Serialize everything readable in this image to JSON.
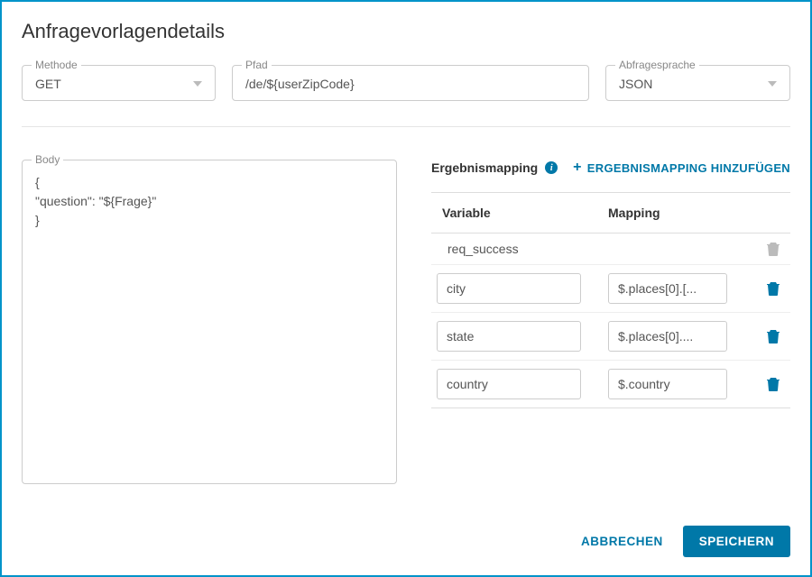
{
  "title": "Anfragevorlagendetails",
  "fields": {
    "method": {
      "label": "Methode",
      "value": "GET"
    },
    "path": {
      "label": "Pfad",
      "value": "/de/${userZipCode}"
    },
    "lang": {
      "label": "Abfragesprache",
      "value": "JSON"
    },
    "body": {
      "label": "Body",
      "value": "{\n\"question\": \"${Frage}\"\n}"
    }
  },
  "mapping": {
    "title": "Ergebnismapping",
    "add_label": "ERGEBNISMAPPING HINZUFÜGEN",
    "columns": {
      "variable": "Variable",
      "mapping": "Mapping"
    },
    "rows": [
      {
        "variable": "req_success",
        "mapping": "",
        "editable": false
      },
      {
        "variable": "city",
        "mapping": "$.places[0].[...",
        "editable": true
      },
      {
        "variable": "state",
        "mapping": "$.places[0]....",
        "editable": true
      },
      {
        "variable": "country",
        "mapping": "$.country",
        "editable": true
      }
    ]
  },
  "footer": {
    "cancel": "ABBRECHEN",
    "save": "SPEICHERN"
  }
}
